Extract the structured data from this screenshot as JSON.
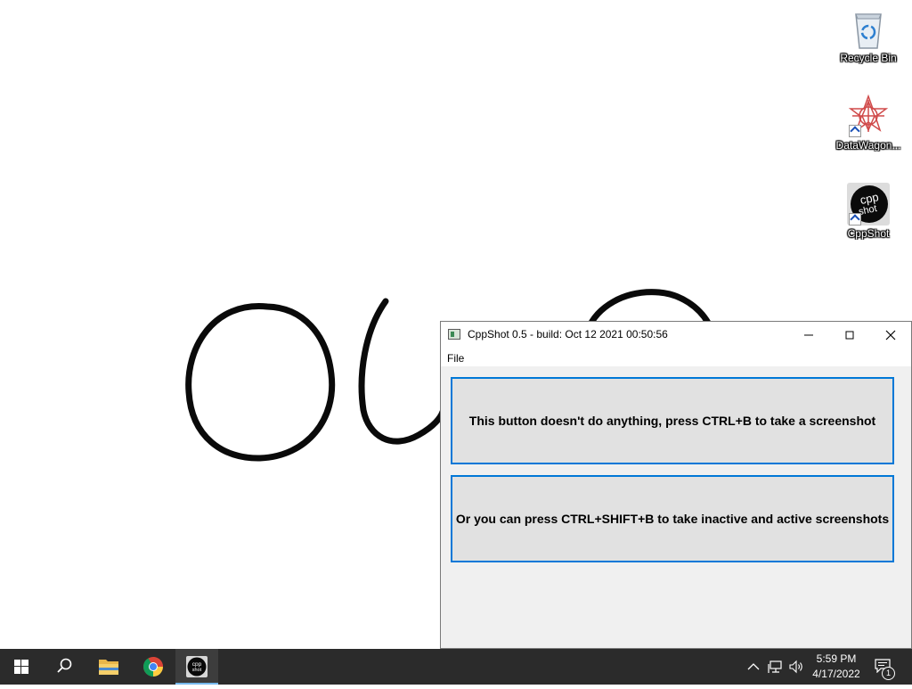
{
  "desktop": {
    "icons": [
      {
        "label": "Recycle Bin"
      },
      {
        "label": "DataWagon..."
      },
      {
        "label": "CppShot"
      }
    ]
  },
  "window": {
    "title": "CppShot 0.5 - build: Oct 12 2021 00:50:56",
    "menu": {
      "file": "File"
    },
    "buttons": [
      {
        "label": "This button doesn't do anything, press CTRL+B to take a screenshot"
      },
      {
        "label": "Or you can press CTRL+SHIFT+B to take inactive and active screenshots"
      }
    ],
    "cppshot_logo": "cpp shot"
  },
  "taskbar": {
    "time": "5:59 PM",
    "date": "4/17/2022",
    "notification_count": "1",
    "pinned": [
      "start-icon",
      "search-icon",
      "file-explorer-icon",
      "chrome-icon",
      "cppshot-icon"
    ]
  },
  "colors": {
    "accent": "#0078d7",
    "taskbar": "#2b2b2b",
    "active_indicator": "#76b9ed"
  }
}
